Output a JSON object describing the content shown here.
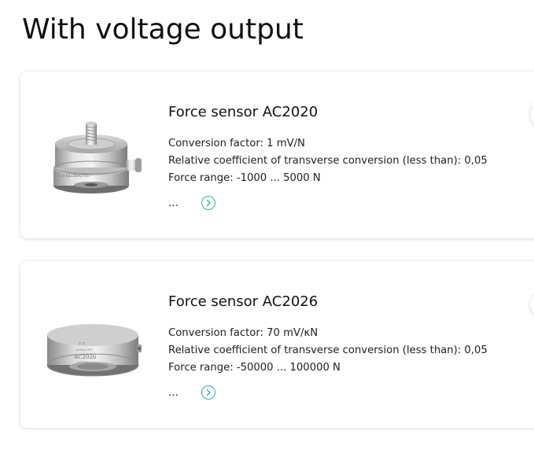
{
  "section": {
    "title": "With voltage output"
  },
  "products": [
    {
      "name": "Force sensor AC2020",
      "specs": [
        "Conversion factor: 1 mV/N",
        "Relative coefficient of transverse conversion (less than): 0,05",
        "Force range: -1000 ... 5000 N"
      ],
      "more_text": "...",
      "image_icon": "force-sensor-ac2020-image"
    },
    {
      "name": "Force sensor AC2026",
      "specs": [
        "Conversion factor: 70 mV/κN",
        "Relative coefficient of transverse conversion (less than): 0,05",
        "Force range: -50000 ... 100000 N"
      ],
      "more_text": "...",
      "image_icon": "force-sensor-ac2026-image"
    }
  ],
  "colors": {
    "accent": "#2ab5a0",
    "card_background": "#ffffff",
    "text": "#1a1a1a"
  },
  "icons": {
    "more": "chevron-right-circle-icon"
  }
}
